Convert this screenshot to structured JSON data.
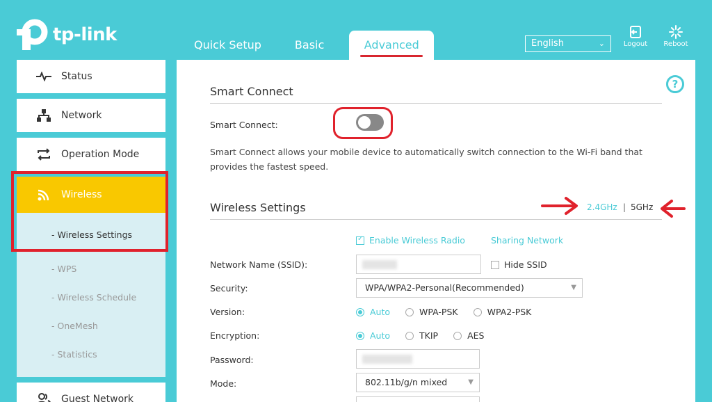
{
  "brand": {
    "name": "tp-link"
  },
  "topnav": {
    "tabs": [
      {
        "label": "Quick Setup"
      },
      {
        "label": "Basic"
      },
      {
        "label": "Advanced"
      }
    ]
  },
  "header": {
    "language": "English",
    "logout": {
      "label": "Logout",
      "icon": "logout-icon"
    },
    "reboot": {
      "label": "Reboot",
      "icon": "reboot-icon"
    }
  },
  "sidebar": {
    "items": [
      {
        "label": "Status",
        "icon": "pulse-icon"
      },
      {
        "label": "Network",
        "icon": "network-icon"
      },
      {
        "label": "Operation Mode",
        "icon": "operation-mode-icon"
      },
      {
        "label": "Wireless",
        "icon": "wireless-icon"
      },
      {
        "label": "Guest Network",
        "icon": "guest-icon"
      }
    ],
    "wireless_sub": [
      {
        "label": "- Wireless Settings"
      },
      {
        "label": "- WPS"
      },
      {
        "label": "- Wireless Schedule"
      },
      {
        "label": "- OneMesh"
      },
      {
        "label": "- Statistics"
      }
    ]
  },
  "smart_connect": {
    "title": "Smart Connect",
    "label": "Smart Connect:",
    "enabled": false,
    "description": "Smart Connect allows your mobile device to automatically switch connection to the Wi-Fi band that provides the fastest speed."
  },
  "wireless": {
    "title": "Wireless Settings",
    "bands": {
      "band_24": "2.4GHz",
      "sep": "|",
      "band_5": "5GHz"
    },
    "enable_radio": "Enable Wireless Radio",
    "sharing_network": "Sharing Network",
    "ssid_label": "Network Name (SSID):",
    "hide_ssid": "Hide SSID",
    "security_label": "Security:",
    "security_value": "WPA/WPA2-Personal(Recommended)",
    "version_label": "Version:",
    "version_options": [
      "Auto",
      "WPA-PSK",
      "WPA2-PSK"
    ],
    "encryption_label": "Encryption:",
    "encryption_options": [
      "Auto",
      "TKIP",
      "AES"
    ],
    "password_label": "Password:",
    "mode_label": "Mode:",
    "mode_value": "802.11b/g/n mixed"
  },
  "colors": {
    "accent": "#4acbd6",
    "active_menu": "#f9c800",
    "annotation_red": "#e0222c"
  }
}
